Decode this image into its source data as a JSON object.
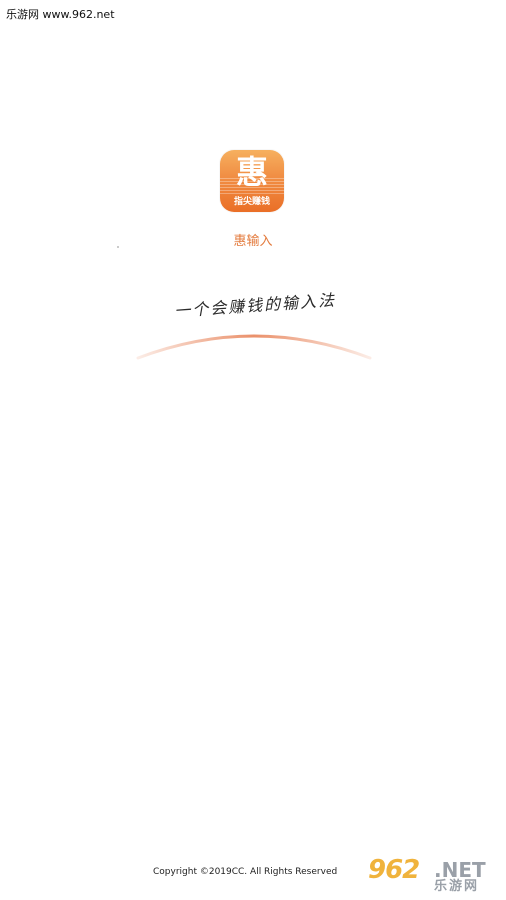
{
  "watermark": {
    "top_text": "乐游网 www.962.net",
    "logo_number": "962",
    "logo_domain": ".NET",
    "logo_cn": "乐游网"
  },
  "app": {
    "icon_glyph": "惠",
    "icon_caption": "指尖赚钱",
    "name": "惠输入",
    "slogan": "一个会赚钱的输入法"
  },
  "footer": {
    "copyright": "Copyright ©2019CC. All Rights Reserved"
  },
  "colors": {
    "brand_orange": "#ea6f27",
    "icon_gradient_top": "#f6b05f",
    "name_color": "#e37a3c",
    "arc_color": "#e8845a",
    "watermark_yellow": "#f0b33c",
    "watermark_gray": "#9aa0a8"
  }
}
